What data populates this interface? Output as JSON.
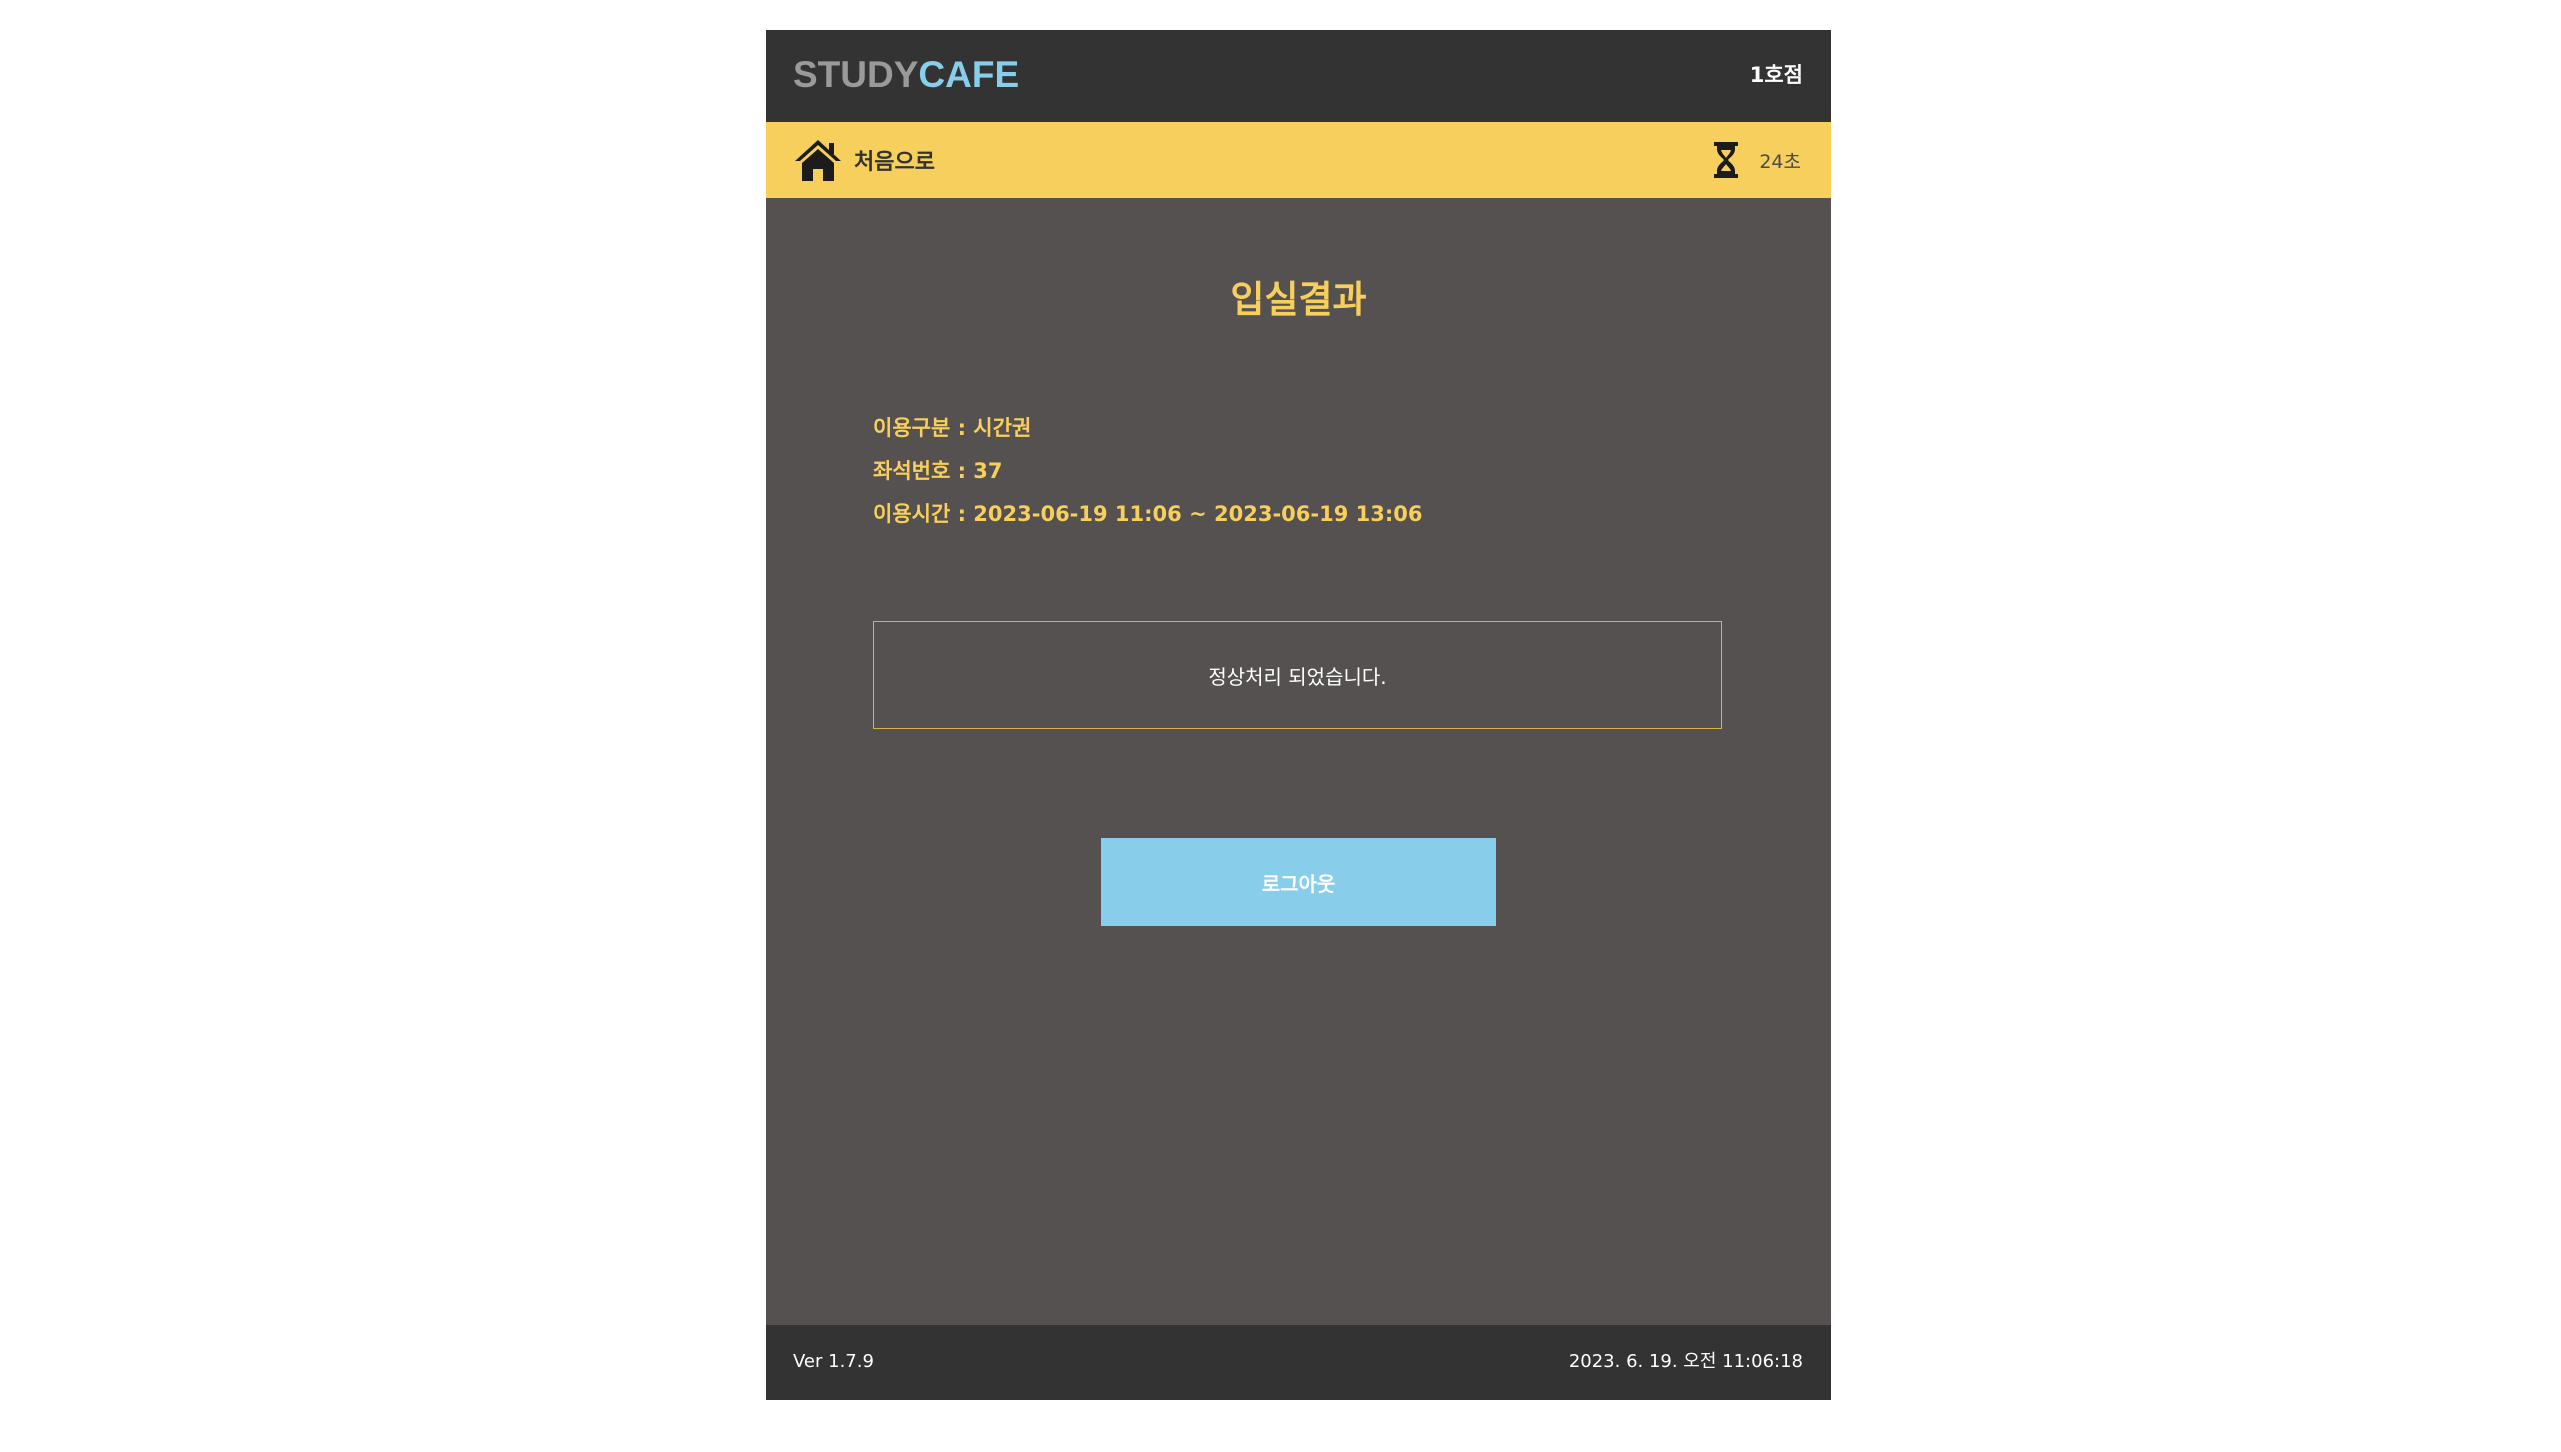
{
  "header": {
    "logo_part1": "STUDY",
    "logo_part2": "CAFE",
    "branch": "1호점"
  },
  "nav": {
    "home_icon": "home-icon",
    "home_label": "처음으로",
    "timer_icon": "hourglass-icon",
    "timer_text": "24초"
  },
  "main": {
    "title": "입실결과",
    "info": [
      "이용구분 : 시간권",
      "좌석번호 : 37",
      "이용시간 : 2023-06-19 11:06 ~ 2023-06-19 13:06"
    ],
    "message": "정상처리 되었습니다.",
    "logout_label": "로그아웃"
  },
  "footer": {
    "version": "Ver 1.7.9",
    "datetime": "2023. 6. 19. 오전 11:06:18"
  },
  "colors": {
    "header_bg": "#333333",
    "nav_bg": "#f7cf5d",
    "main_bg": "#565151",
    "accent_yellow": "#f7cf5d",
    "accent_blue": "#88cdea",
    "logo_gray": "#9a9a9a"
  }
}
